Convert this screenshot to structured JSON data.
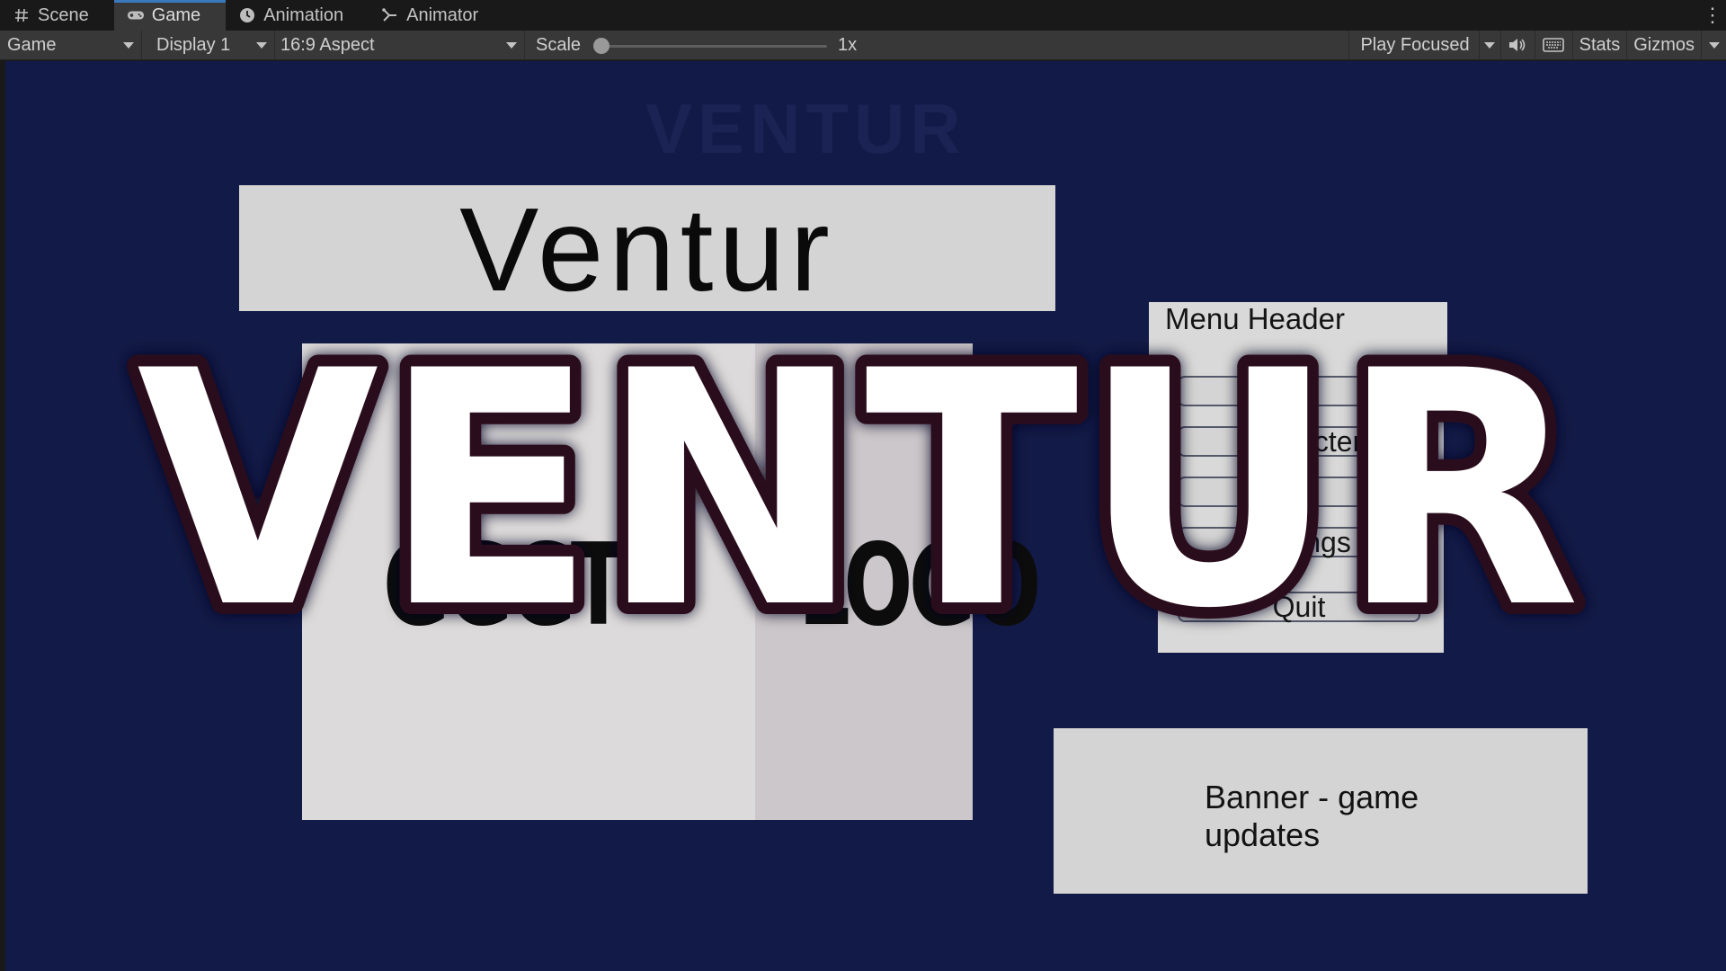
{
  "tabs": [
    {
      "label": "Scene",
      "icon": "hash-icon",
      "active": false
    },
    {
      "label": "Game",
      "icon": "gamepad-icon",
      "active": true
    },
    {
      "label": "Animation",
      "icon": "clock-icon",
      "active": false
    },
    {
      "label": "Animator",
      "icon": "animator-icon",
      "active": false
    }
  ],
  "toolbar": {
    "view_mode": "Game",
    "display": "Display 1",
    "aspect": "16:9 Aspect",
    "scale_label": "Scale",
    "scale_value": "1x",
    "scale_level": 0,
    "play_mode": "Play Focused",
    "stats_label": "Stats",
    "gizmos_label": "Gizmos"
  },
  "game": {
    "background_color": "#121a47",
    "title_panel_text": "Ventur",
    "logo_left_text": "GGGT",
    "logo_right_text": "LOGO",
    "menu_header": "Menu Header",
    "menu_buttons": [
      "",
      "Character",
      "",
      "Settings",
      "Quit"
    ],
    "banner_text": "Banner - game updates",
    "overlay_title": "VENTUR",
    "overlay_fill": "#ffffff",
    "overlay_stroke": "#2a0d1e"
  }
}
